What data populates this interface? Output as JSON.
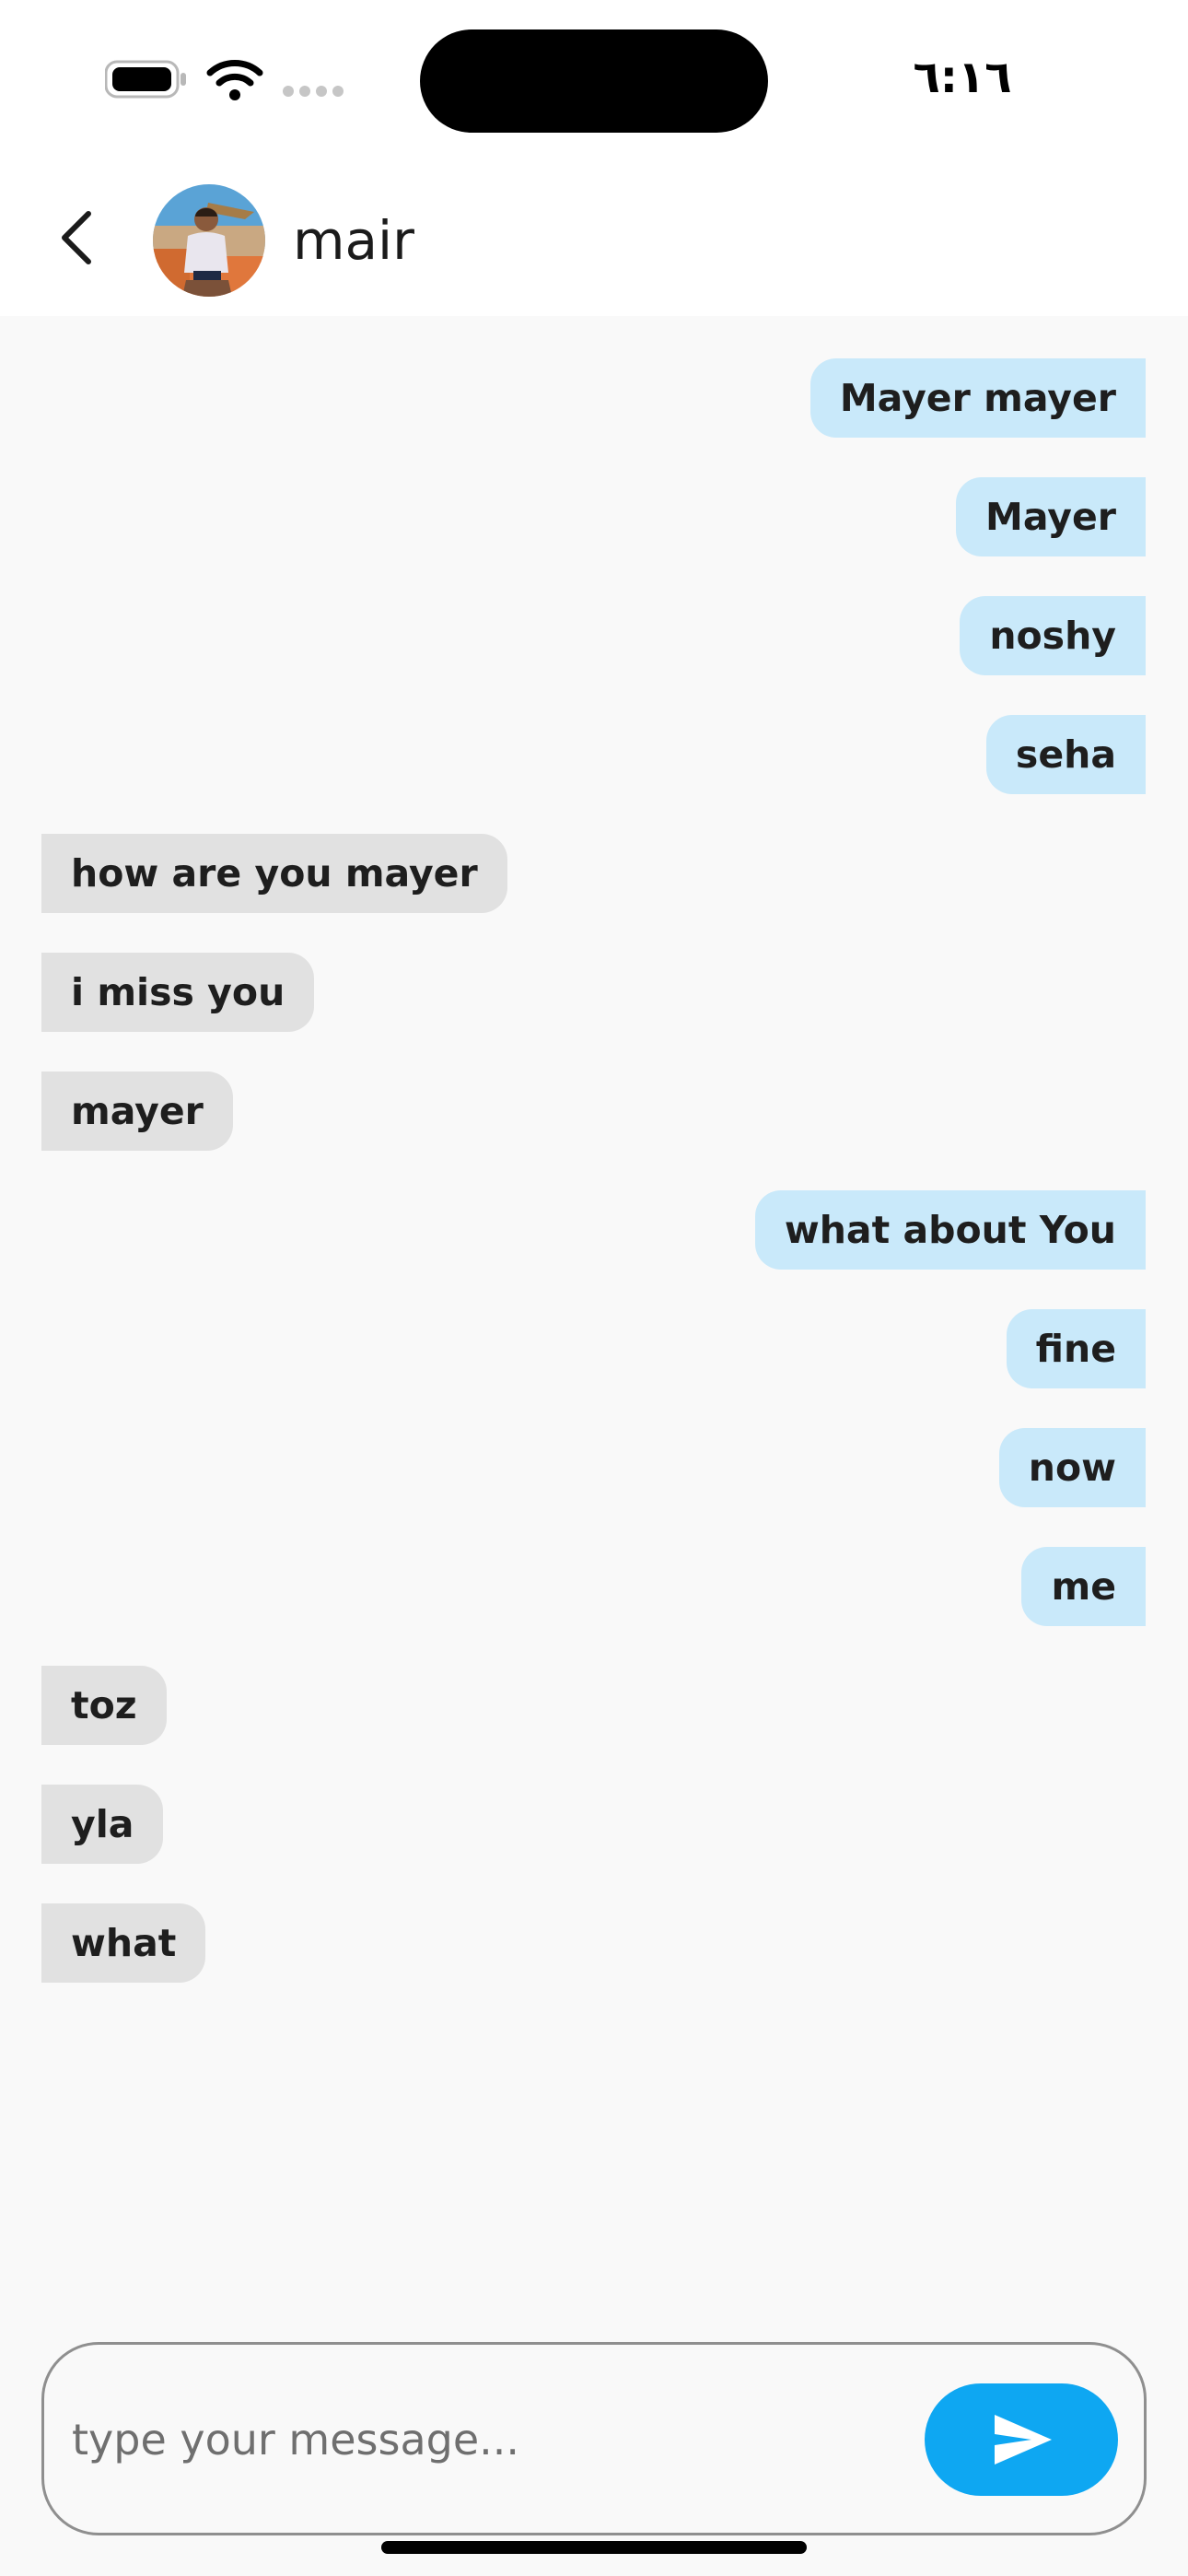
{
  "status_bar": {
    "time": "٦:١٦",
    "icons": [
      "battery-icon",
      "wifi-icon",
      "signal-dots-icon"
    ]
  },
  "header": {
    "contact_name": "mair",
    "back_icon": "chevron-left-icon",
    "avatar": "contact-avatar-photo"
  },
  "messages": [
    {
      "text": "Mayer mayer",
      "direction": "outgoing"
    },
    {
      "text": "Mayer",
      "direction": "outgoing"
    },
    {
      "text": "noshy",
      "direction": "outgoing"
    },
    {
      "text": "seha",
      "direction": "outgoing"
    },
    {
      "text": "how are you mayer",
      "direction": "incoming"
    },
    {
      "text": "i miss you",
      "direction": "incoming"
    },
    {
      "text": "mayer",
      "direction": "incoming"
    },
    {
      "text": "what about You",
      "direction": "outgoing"
    },
    {
      "text": "fine",
      "direction": "outgoing"
    },
    {
      "text": "now",
      "direction": "outgoing"
    },
    {
      "text": "me",
      "direction": "outgoing"
    },
    {
      "text": "toz",
      "direction": "incoming"
    },
    {
      "text": "yla",
      "direction": "incoming"
    },
    {
      "text": "what",
      "direction": "incoming"
    }
  ],
  "composer": {
    "placeholder": "type your message...",
    "value": "",
    "send_icon": "send-icon"
  },
  "colors": {
    "outgoing_bubble": "#c9e9fa",
    "incoming_bubble": "#e1e1e1",
    "send_button": "#0ea7f2",
    "background": "#f9f9f9"
  }
}
